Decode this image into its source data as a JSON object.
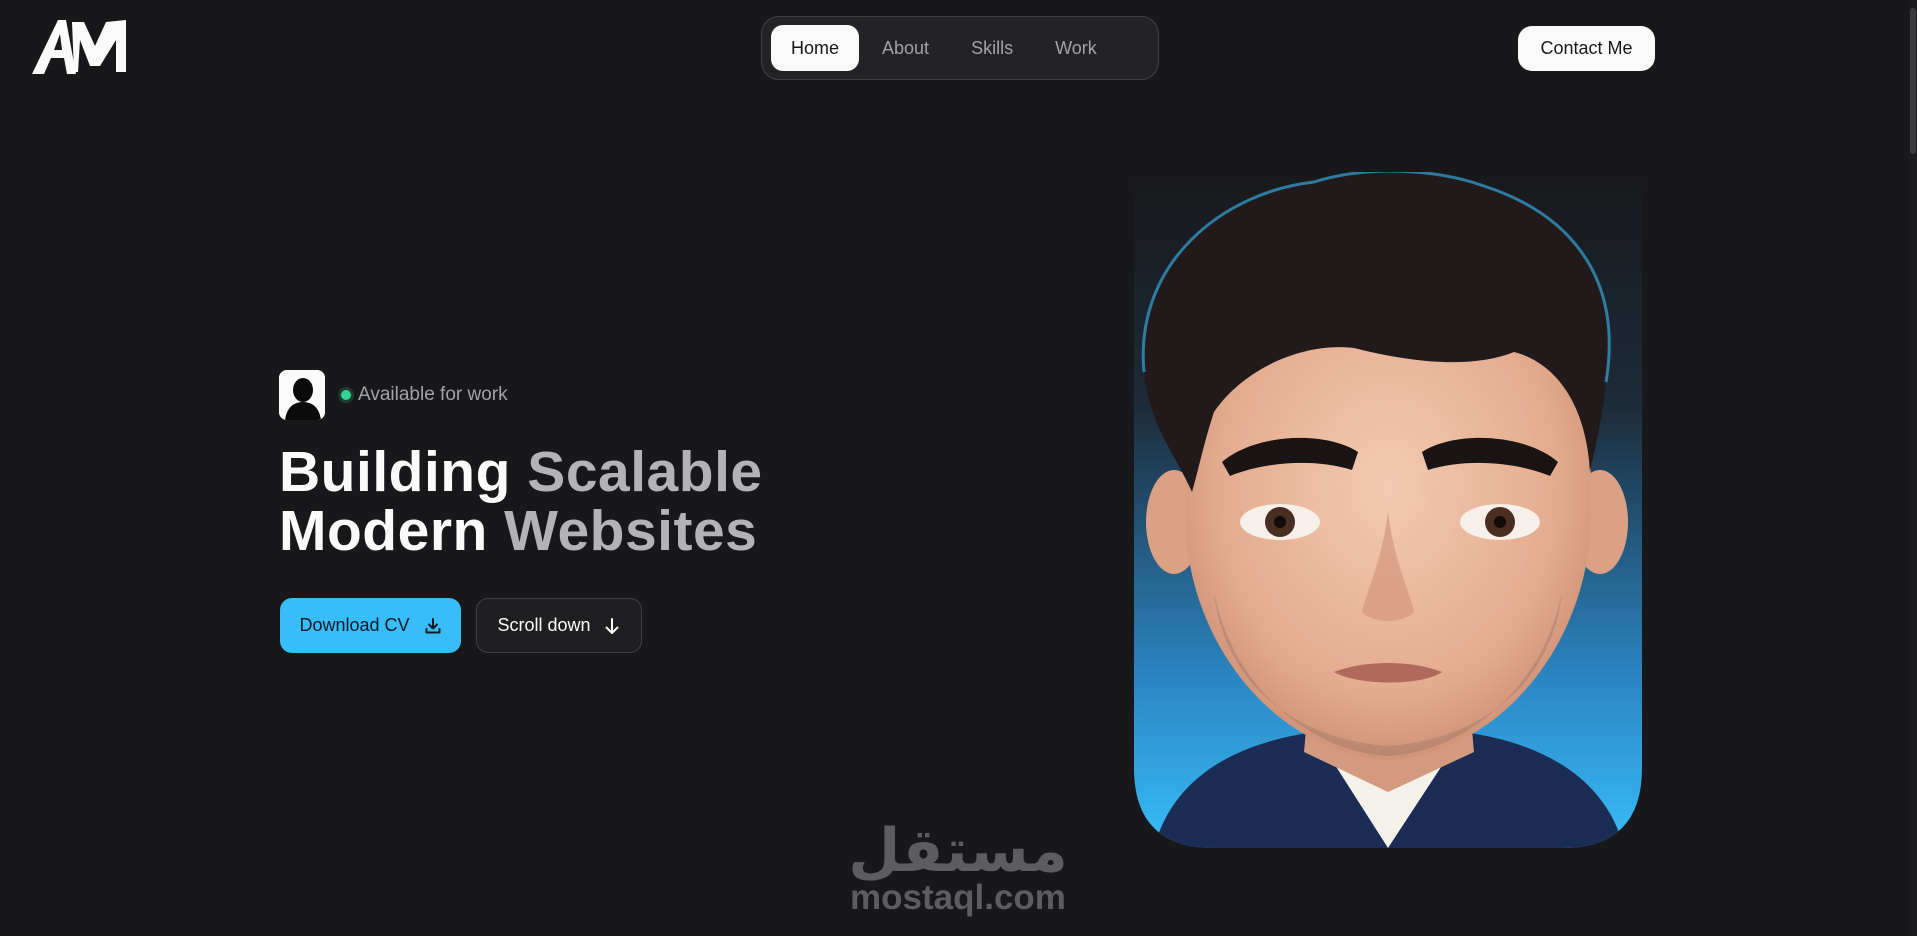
{
  "brand": {
    "logo_text": "AM"
  },
  "nav": {
    "items": [
      {
        "label": "Home",
        "active": true
      },
      {
        "label": "About",
        "active": false
      },
      {
        "label": "Skills",
        "active": false
      },
      {
        "label": "Work",
        "active": false
      }
    ]
  },
  "header": {
    "contact_label": "Contact Me"
  },
  "hero": {
    "status_text": "Available for work",
    "headline_line1_a": "Building",
    "headline_line1_b": "Scalable",
    "headline_line2_a": "Modern",
    "headline_line2_b": "Websites",
    "primary_button_label": "Download CV",
    "primary_button_icon": "download-icon",
    "secondary_button_label": "Scroll down",
    "secondary_button_icon": "arrow-down-icon"
  },
  "watermark": {
    "arabic_text": "مستقل",
    "latin_text": "mostaql.com"
  },
  "colors": {
    "background": "#18181b",
    "accent": "#38bdf8",
    "status_green": "#34d399",
    "muted_text": "#a1a1aa"
  }
}
